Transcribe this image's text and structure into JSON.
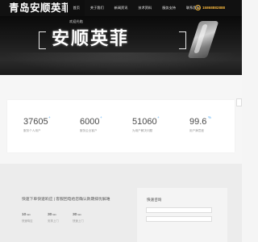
{
  "header": {
    "logo": "青岛安顺英菲行",
    "nav": [
      "首页",
      "关于我们",
      "新闻资讯",
      "技术资料",
      "服务支持",
      "联系我们"
    ],
    "phone": "15868882888"
  },
  "banner": {
    "welcome": "欢迎光临",
    "title": "安顺英菲"
  },
  "stats": [
    {
      "value": "37605",
      "plus": "+",
      "label": "服务个人用户"
    },
    {
      "value": "6000",
      "plus": "+",
      "label": "服务企业客户"
    },
    {
      "value": "51060",
      "plus": "+",
      "label": "为用户解决问题"
    },
    {
      "value": "99.6",
      "plus": "%",
      "label": "用户满意度"
    }
  ],
  "contact": {
    "title": "快速下单快速响应 | 客服回电给您确认款期排忧解难",
    "metrics": [
      {
        "value": "10",
        "unit": "min",
        "label": "快速响应"
      },
      {
        "value": "30",
        "unit": "min",
        "label": "安排上门"
      },
      {
        "value": "30",
        "unit": "min",
        "label": "快速上门"
      }
    ]
  },
  "quick": {
    "title": "快速咨询"
  }
}
